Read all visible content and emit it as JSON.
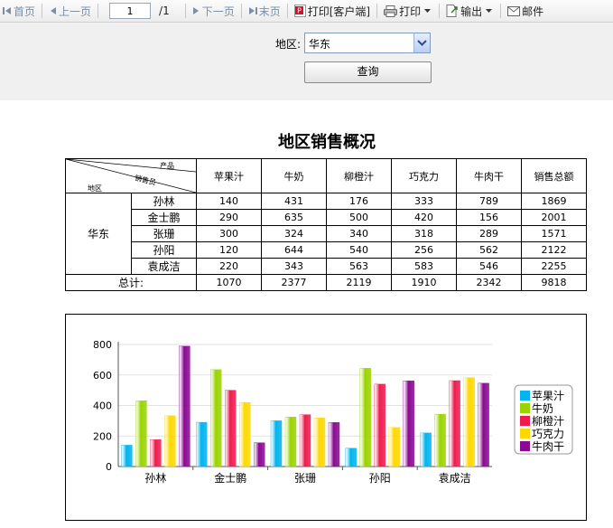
{
  "toolbar": {
    "first": "首页",
    "prev": "上一页",
    "page_value": "1",
    "page_total": "/1",
    "next": "下一页",
    "last": "末页",
    "print_client": "打印[客户端]",
    "print": "打印",
    "export": "输出",
    "mail": "邮件"
  },
  "filter": {
    "region_label": "地区:",
    "region_value": "华东",
    "query_label": "查询"
  },
  "report": {
    "title": "地区销售概况",
    "corner_product": "产品",
    "corner_sales": "销售员",
    "corner_region": "地区",
    "columns": [
      "苹果汁",
      "牛奶",
      "柳橙汁",
      "巧克力",
      "牛肉干",
      "销售总额"
    ],
    "region": "华东",
    "rows": [
      {
        "name": "孙林",
        "values": [
          "140",
          "431",
          "176",
          "333",
          "789",
          "1869"
        ]
      },
      {
        "name": "金士鹏",
        "values": [
          "290",
          "635",
          "500",
          "420",
          "156",
          "2001"
        ]
      },
      {
        "name": "张珊",
        "values": [
          "300",
          "324",
          "340",
          "318",
          "289",
          "1571"
        ]
      },
      {
        "name": "孙阳",
        "values": [
          "120",
          "644",
          "540",
          "256",
          "562",
          "2122"
        ]
      },
      {
        "name": "袁成洁",
        "values": [
          "220",
          "343",
          "563",
          "583",
          "546",
          "2255"
        ]
      }
    ],
    "total_label": "总计:",
    "totals": [
      "1070",
      "2377",
      "2119",
      "1910",
      "2342",
      "9818"
    ]
  },
  "chart_data": {
    "type": "bar",
    "categories": [
      "孙林",
      "金士鹏",
      "张珊",
      "孙阳",
      "袁成洁"
    ],
    "series": [
      {
        "name": "苹果汁",
        "color": "#00b4f0",
        "values": [
          140,
          290,
          300,
          120,
          220
        ]
      },
      {
        "name": "牛奶",
        "color": "#9ad400",
        "values": [
          431,
          635,
          324,
          644,
          343
        ]
      },
      {
        "name": "柳橙汁",
        "color": "#ee1c4e",
        "values": [
          176,
          500,
          340,
          540,
          563
        ]
      },
      {
        "name": "巧克力",
        "color": "#ffd800",
        "values": [
          333,
          420,
          318,
          256,
          583
        ]
      },
      {
        "name": "牛肉干",
        "color": "#8a0a92",
        "values": [
          789,
          156,
          289,
          562,
          546
        ]
      }
    ],
    "yticks": [
      "0",
      "200",
      "400",
      "600",
      "800"
    ],
    "ylim": [
      0,
      800
    ],
    "legend": "right"
  }
}
